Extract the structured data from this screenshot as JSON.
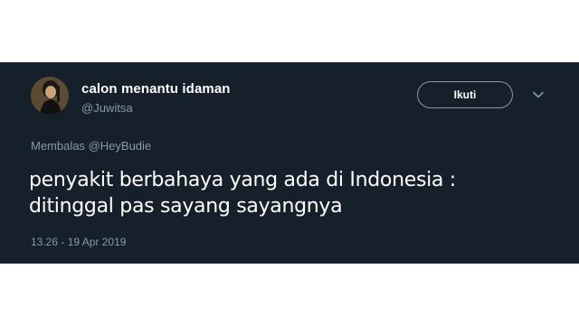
{
  "tweet": {
    "display_name": "calon menantu idaman",
    "handle": "@Juwitsa",
    "follow_label": "Ikuti",
    "reply_prefix": "Membalas",
    "reply_mention": "@HeyBudie",
    "text_line1": "penyakit berbahaya yang ada di Indonesia :",
    "text_line2": "ditinggal pas sayang sayangnya",
    "timestamp": "13.26 - 19 Apr 2019",
    "icons": {
      "avatar": "user-avatar",
      "menu": "chevron-down-icon"
    },
    "colors": {
      "background": "#15202b",
      "primary_text": "#ffffff",
      "secondary_text": "#8899a6",
      "button_border": "#8899a6"
    }
  }
}
